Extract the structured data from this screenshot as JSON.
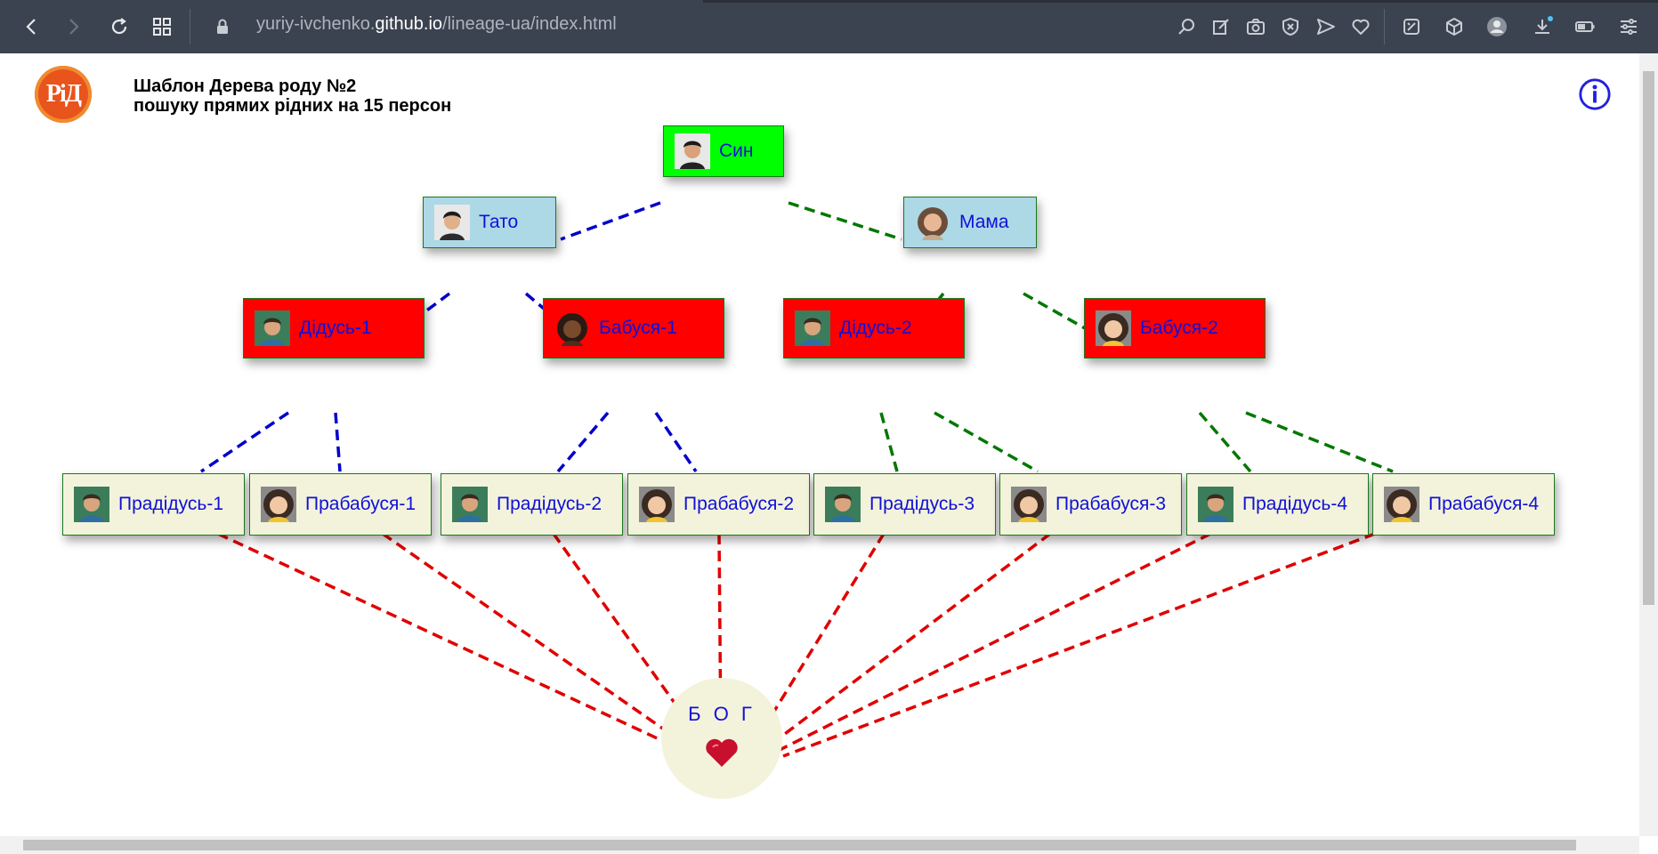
{
  "browser": {
    "url_prefix": "yuriy-ivchenko.",
    "url_host": "github.io",
    "url_path": "/lineage-ua/index.html"
  },
  "header": {
    "logo_text": "РіД",
    "title_line1": "Шаблон Дерева роду №2",
    "title_line2": "пошуку прямих рідних на 15 персон"
  },
  "tree": {
    "son": "Син",
    "father": "Тато",
    "mother": "Мама",
    "grandfather1": "Дідусь-1",
    "grandmother1": "Бабуся-1",
    "grandfather2": "Дідусь-2",
    "grandmother2": "Бабуся-2",
    "ggf1": "Прадідусь-1",
    "ggm1": "Прабабуся-1",
    "ggf2": "Прадідусь-2",
    "ggm2": "Прабабуся-2",
    "ggf3": "Прадідусь-3",
    "ggm3": "Прабабуся-3",
    "ggf4": "Прадідусь-4",
    "ggm4": "Прабабуся-4"
  },
  "god": {
    "label": "Б О Г",
    "icon": "heart-icon"
  },
  "colors": {
    "son_bg": "#00ff00",
    "parents_bg": "#add8e6",
    "grandparents_bg": "#ff0000",
    "great_grandparents_bg": "#f3f3dc",
    "paternal_line": "#0000cc",
    "maternal_line": "#007700",
    "god_line": "#e00000",
    "label_text": "#1010d8"
  }
}
